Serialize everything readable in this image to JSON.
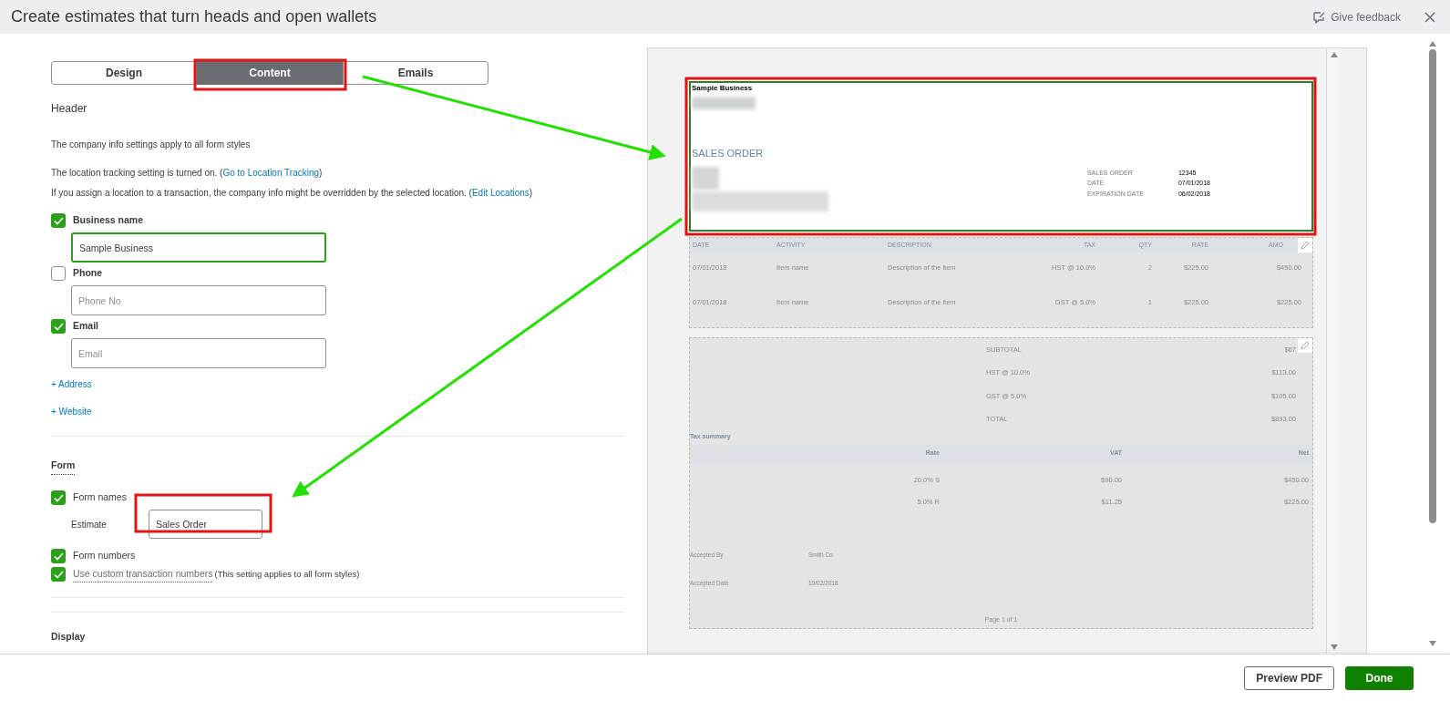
{
  "window": {
    "title": "Create estimates that turn heads and open wallets",
    "feedback": "Give feedback"
  },
  "tabs": [
    {
      "label": "Design",
      "selected": false
    },
    {
      "label": "Content",
      "selected": true
    },
    {
      "label": "Emails",
      "selected": false
    }
  ],
  "header": {
    "heading": "Header",
    "note": "The company info settings apply to all form styles",
    "location": {
      "before": "The location tracking setting is turned on. (",
      "link": "Go to Location Tracking",
      "after": ")"
    },
    "assign": {
      "before": "If you assign a location to a transaction, the company info might be overridden by the selected location. (",
      "link": "Edit Locations",
      "after": ")"
    },
    "fields": [
      {
        "label": "Business name",
        "checked": true,
        "value": "Sample Business",
        "focused": true
      },
      {
        "label": "Phone",
        "checked": false,
        "placeholder": "Phone No",
        "focused": false
      },
      {
        "label": "Email",
        "checked": true,
        "placeholder": "Email",
        "focused": false
      }
    ],
    "links": [
      "+ Address",
      "+ Website"
    ]
  },
  "form": {
    "heading": "Form",
    "form_names": {
      "label": "Form names",
      "checked": true
    },
    "estimate_label": "Estimate",
    "estimate_value": "Sales Order",
    "form_numbers": {
      "label": "Form numbers",
      "checked": true
    },
    "custom_numbers": {
      "label": "Use custom transaction numbers",
      "note": "(This setting applies to all form styles)",
      "checked": true
    }
  },
  "display": {
    "heading": "Display"
  },
  "preview": {
    "business": "Sample Business",
    "form_title": "SALES ORDER",
    "meta": [
      [
        "SALES ORDER",
        "12345"
      ],
      [
        "DATE",
        "07/01/2018"
      ],
      [
        "EXPIRATION DATE",
        "06/02/2018"
      ]
    ],
    "columns": [
      "DATE",
      "ACTIVITY",
      "DESCRIPTION",
      "TAX",
      "QTY",
      "RATE",
      "AMO"
    ],
    "rows": [
      [
        "07/01/2018",
        "Item name",
        "Description of the item",
        "HST @ 10.0%",
        "2",
        "$225.00",
        "$450.00"
      ],
      [
        "07/01/2018",
        "Item name",
        "Description of the item",
        "GST @ 5.0%",
        "1",
        "$225.00",
        "$225.00"
      ]
    ],
    "totals": [
      [
        "SUBTOTAL",
        "$67"
      ],
      [
        "HST @ 10.0%",
        "$113.00"
      ],
      [
        "GST @ 5.0%",
        "$105.00"
      ],
      [
        "TOTAL",
        "$893.00"
      ]
    ],
    "tax_summary": {
      "title": "Tax summary",
      "columns": [
        "Rate",
        "VAT",
        "Net"
      ],
      "rows": [
        [
          "20.0% S",
          "$90.00",
          "$450.00"
        ],
        [
          "5.0% R",
          "$11.25",
          "$225.00"
        ]
      ]
    },
    "accepted": [
      [
        "Accepted By",
        "Smith Co."
      ],
      [
        "Accepted Date",
        "10/02/2018"
      ]
    ],
    "page": "Page 1 of 1"
  },
  "footer": {
    "buttons": [
      {
        "label": "Preview PDF",
        "kind": "secondary"
      },
      {
        "label": "Done",
        "kind": "primary"
      }
    ]
  }
}
